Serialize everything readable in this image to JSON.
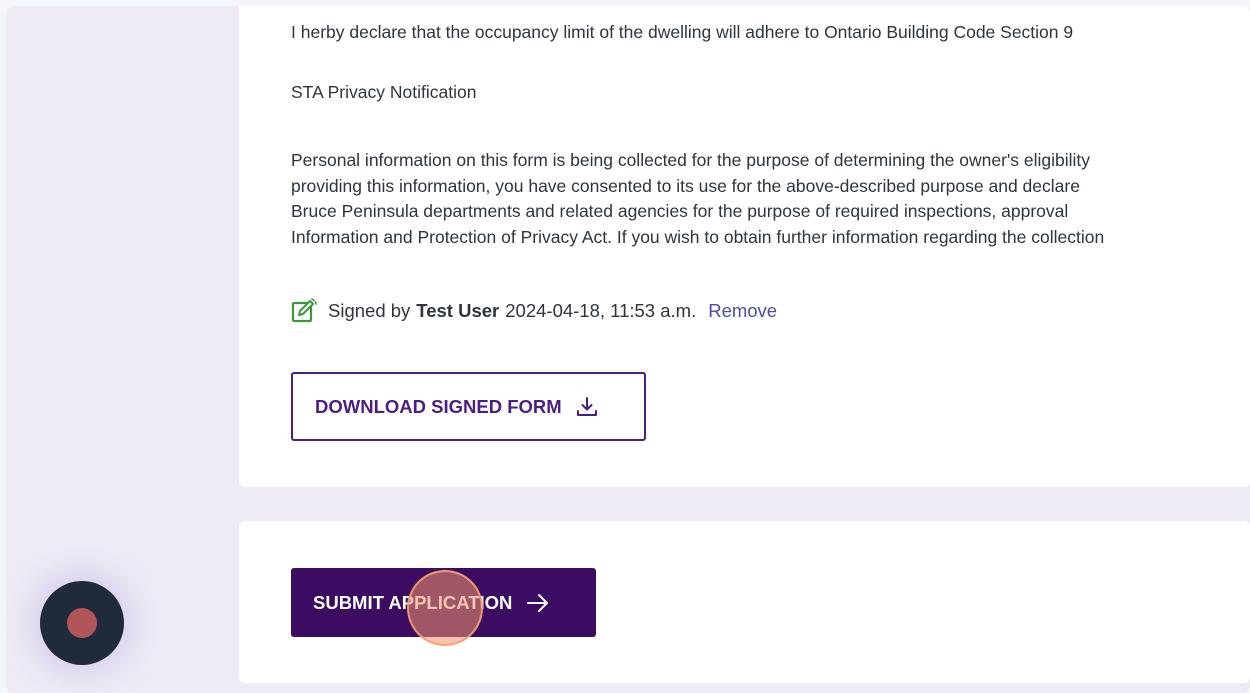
{
  "declaration": {
    "text": "I herby declare that the occupancy limit of the dwelling will adhere to Ontario Building Code Section 9"
  },
  "privacy": {
    "heading": "STA Privacy Notification",
    "lines": [
      "Personal information on this form is being collected for the purpose of determining the owner's eligibility",
      "providing this information, you have consented to its use for the above-described purpose and declare",
      "Bruce Peninsula departments and related agencies for the purpose of required inspections, approval",
      "Information and Protection of Privacy Act. If you wish to obtain further information regarding the collection"
    ]
  },
  "signature": {
    "prefix": "Signed by",
    "user": "Test User",
    "datetime": "2024-04-18, 11:53 a.m.",
    "remove_label": "Remove",
    "icon": "signature-edit-icon",
    "icon_color": "#3a9a3a"
  },
  "download_button": {
    "label": "DOWNLOAD SIGNED FORM",
    "icon": "download-icon"
  },
  "submit_button": {
    "label": "SUBMIT APPLICATION",
    "icon": "arrow-right-icon"
  },
  "colors": {
    "primary": "#3c0c63",
    "outline": "#4d1d83",
    "link": "#4b4bb0",
    "background": "#eeebf6"
  }
}
